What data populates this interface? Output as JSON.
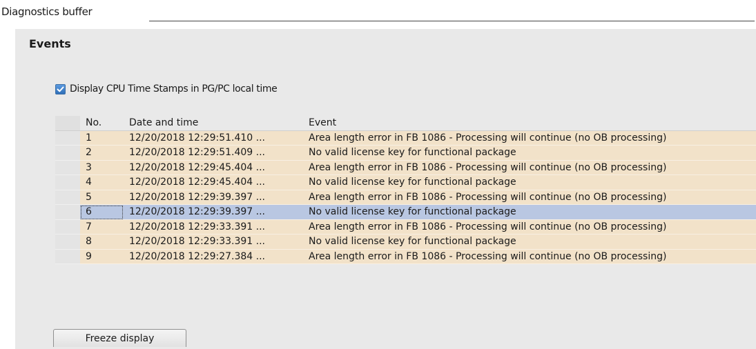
{
  "header": {
    "title": "Diagnostics buffer"
  },
  "section": {
    "title": "Events"
  },
  "checkbox": {
    "label": "Display CPU Time Stamps in PG/PC local time",
    "checked": true
  },
  "table": {
    "columns": [
      "No.",
      "Date and time",
      "Event"
    ],
    "rows": [
      {
        "no": "1",
        "datetime": "12/20/2018 12:29:51.410 ...",
        "event": "Area length error in FB 1086  - Processing will continue (no OB processing)"
      },
      {
        "no": "2",
        "datetime": "12/20/2018 12:29:51.409 ...",
        "event": "No valid license key for functional package"
      },
      {
        "no": "3",
        "datetime": "12/20/2018 12:29:45.404 ...",
        "event": "Area length error in FB 1086  - Processing will continue (no OB processing)"
      },
      {
        "no": "4",
        "datetime": "12/20/2018 12:29:45.404 ...",
        "event": "No valid license key for functional package"
      },
      {
        "no": "5",
        "datetime": "12/20/2018 12:29:39.397 ...",
        "event": "Area length error in FB 1086  - Processing will continue (no OB processing)"
      },
      {
        "no": "6",
        "datetime": "12/20/2018 12:29:39.397 ...",
        "event": "No valid license key for functional package"
      },
      {
        "no": "7",
        "datetime": "12/20/2018 12:29:33.391 ...",
        "event": "Area length error in FB 1086  - Processing will continue (no OB processing)"
      },
      {
        "no": "8",
        "datetime": "12/20/2018 12:29:33.391 ...",
        "event": "No valid license key for functional package"
      },
      {
        "no": "9",
        "datetime": "12/20/2018 12:29:27.384 ...",
        "event": "Area length error in FB 1086  - Processing will continue (no OB processing)"
      }
    ],
    "selected_row": "6"
  },
  "buttons": {
    "freeze_label": "Freeze display"
  },
  "colors": {
    "row_bg": "#f2e2c9",
    "selected_bg": "#b9c7e2",
    "panel_bg": "#e9e9e9",
    "checkbox_accent": "#2f6fb8"
  },
  "icons": {
    "checkmark": "check-icon"
  }
}
